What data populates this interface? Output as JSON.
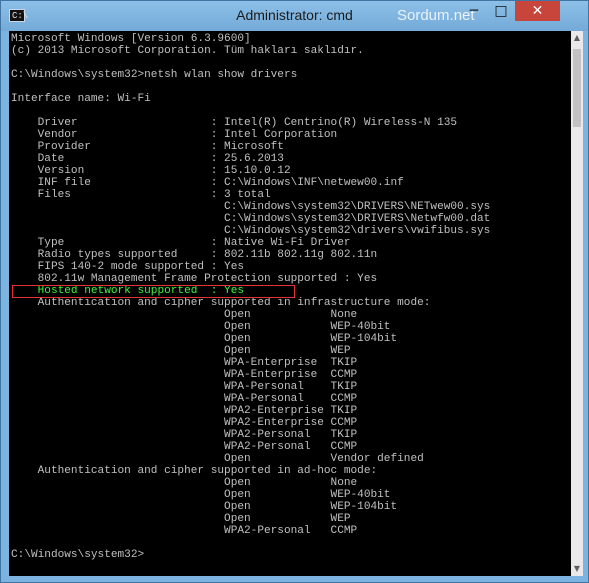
{
  "window": {
    "title": "Administrator: cmd",
    "watermark": "Sordum.net",
    "icon_text": "C:\\",
    "minimize_icon": "minimize-icon",
    "maximize_icon": "maximize-icon",
    "close_icon": "close-icon",
    "minimize_symbol": "─",
    "maximize_symbol": "□",
    "close_symbol": "✕"
  },
  "colors": {
    "console_text": "#c0c0c0",
    "highlight_text": "#3cf43c",
    "highlight_border": "#e23232",
    "close_button": "#c8453b"
  },
  "console": {
    "lines": [
      "Microsoft Windows [Version 6.3.9600]",
      "(c) 2013 Microsoft Corporation. Tüm hakları saklıdır.",
      "",
      "C:\\Windows\\system32>netsh wlan show drivers",
      "",
      "Interface name: Wi-Fi",
      "",
      "    Driver                    : Intel(R) Centrino(R) Wireless-N 135",
      "    Vendor                    : Intel Corporation",
      "    Provider                  : Microsoft",
      "    Date                      : 25.6.2013",
      "    Version                   : 15.10.0.12",
      "    INF file                  : C:\\Windows\\INF\\netwew00.inf",
      "    Files                     : 3 total",
      "                                C:\\Windows\\system32\\DRIVERS\\NETwew00.sys",
      "                                C:\\Windows\\system32\\DRIVERS\\Netwfw00.dat",
      "                                C:\\Windows\\system32\\drivers\\vwifibus.sys",
      "    Type                      : Native Wi-Fi Driver",
      "    Radio types supported     : 802.11b 802.11g 802.11n",
      "    FIPS 140-2 mode supported : Yes",
      "    802.11w Management Frame Protection supported : Yes",
      "    Hosted network supported  : Yes",
      "    Authentication and cipher supported in infrastructure mode:",
      "                                Open            None",
      "                                Open            WEP-40bit",
      "                                Open            WEP-104bit",
      "                                Open            WEP",
      "                                WPA-Enterprise  TKIP",
      "                                WPA-Enterprise  CCMP",
      "                                WPA-Personal    TKIP",
      "                                WPA-Personal    CCMP",
      "                                WPA2-Enterprise TKIP",
      "                                WPA2-Enterprise CCMP",
      "                                WPA2-Personal   TKIP",
      "                                WPA2-Personal   CCMP",
      "                                Open            Vendor defined",
      "    Authentication and cipher supported in ad-hoc mode:",
      "                                Open            None",
      "                                Open            WEP-40bit",
      "                                Open            WEP-104bit",
      "                                Open            WEP",
      "                                WPA2-Personal   CCMP",
      "",
      "C:\\Windows\\system32>"
    ]
  }
}
